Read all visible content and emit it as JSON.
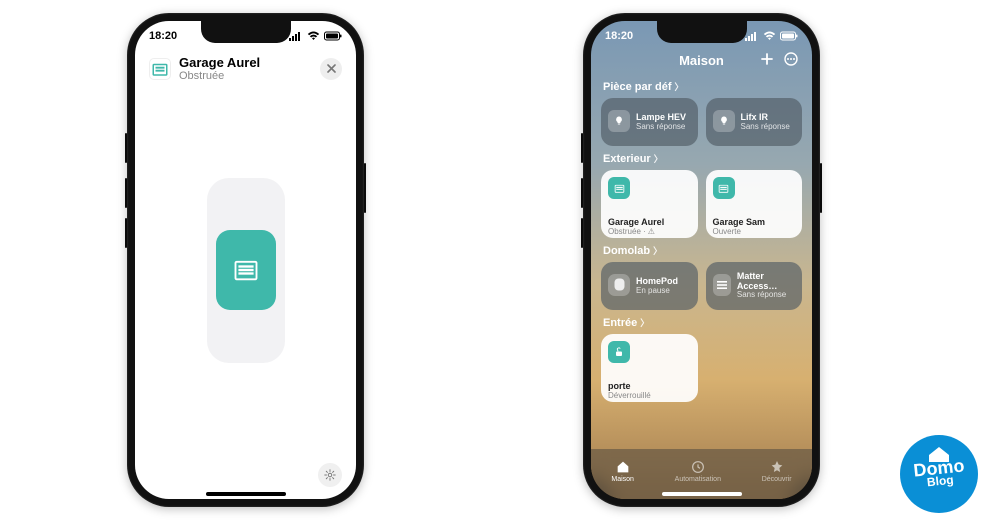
{
  "status": {
    "time": "18:20"
  },
  "detail": {
    "title": "Garage Aurel",
    "subtitle": "Obstruée"
  },
  "home": {
    "title": "Maison",
    "sections": {
      "default_room": {
        "label": "Pièce par déf",
        "tiles": [
          {
            "name": "Lampe HEV",
            "status": "Sans réponse"
          },
          {
            "name": "Lifx IR",
            "status": "Sans réponse"
          }
        ]
      },
      "exterior": {
        "label": "Exterieur",
        "tiles": [
          {
            "name": "Garage Aurel",
            "status": "Obstruée ·",
            "warn": "⚠︎"
          },
          {
            "name": "Garage Sam",
            "status": "Ouverte"
          }
        ]
      },
      "domolab": {
        "label": "Domolab",
        "tiles": [
          {
            "name": "HomePod",
            "status": "En pause"
          },
          {
            "name": "Matter Access…",
            "status": "Sans réponse"
          }
        ]
      },
      "entry": {
        "label": "Entrée",
        "tiles": [
          {
            "name": "porte",
            "status": "Déverrouillé"
          }
        ]
      }
    },
    "tabs": {
      "home": "Maison",
      "automation": "Automatisation",
      "discover": "Découvrir"
    }
  },
  "brand": {
    "line1": "Domo",
    "line2": "Blog"
  },
  "colors": {
    "teal": "#3fb8aa",
    "brand_blue": "#0a8fd6"
  }
}
